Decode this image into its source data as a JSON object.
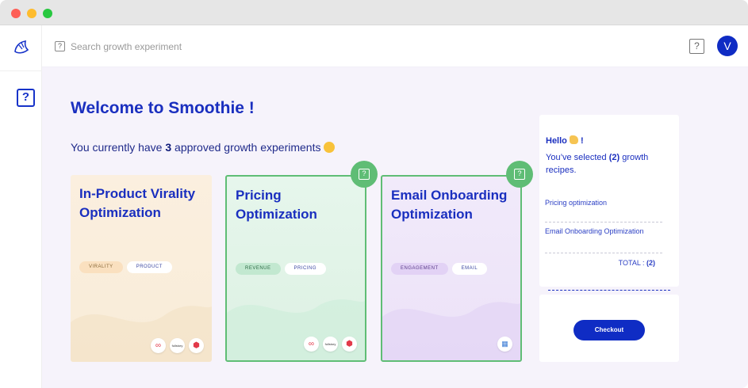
{
  "window": {
    "controls": [
      "close",
      "minimize",
      "zoom"
    ]
  },
  "sidebar": {
    "logo_icon": "croissant-icon",
    "help_icon": "question-box-icon",
    "help_glyph": "?"
  },
  "header": {
    "search_icon": "question-box-icon",
    "search_icon_glyph": "?",
    "search_placeholder": "Search growth experiment",
    "help_icon": "question-box-icon",
    "help_glyph": "?",
    "avatar_initial": "V"
  },
  "main": {
    "title": "Welcome to Smoothie !",
    "subtitle_prefix": "You currently have ",
    "subtitle_count": "3",
    "subtitle_suffix": " approved growth experiments",
    "subtitle_emoji_icon": "smiley-emoji-icon"
  },
  "cards": [
    {
      "title": "In-Product Virality Optimization",
      "tags": [
        "VIRALITY",
        "PRODUCT"
      ],
      "selected": false,
      "logos": [
        "∞",
        "fullstory",
        "⬢"
      ]
    },
    {
      "title": "Pricing Optimization",
      "tags": [
        "REVENUE",
        "PRICING"
      ],
      "selected": true,
      "logos": [
        "∞",
        "fullstory",
        "⬢"
      ]
    },
    {
      "title": "Email Onboarding Optimization",
      "tags": [
        "ENGAGEMENT",
        "EMAIL"
      ],
      "selected": true,
      "logos": [
        "▦"
      ]
    }
  ],
  "summary": {
    "hello": "Hello",
    "hello_suffix": " !",
    "hello_emoji_icon": "waving-hand-icon",
    "selected_prefix": "You’ve selected ",
    "selected_count": "(2)",
    "selected_suffix": " growth recipes.",
    "items": [
      "Pricing optimization",
      "Email Onboarding Optimization"
    ],
    "total_label": "TOTAL : ",
    "total_value": "(2)",
    "checkout_label": "Checkout"
  },
  "colors": {
    "brand": "#0f2cc4",
    "heading": "#1a2fbf",
    "selected_border": "#5fbd75",
    "background": "#f6f3fb"
  }
}
